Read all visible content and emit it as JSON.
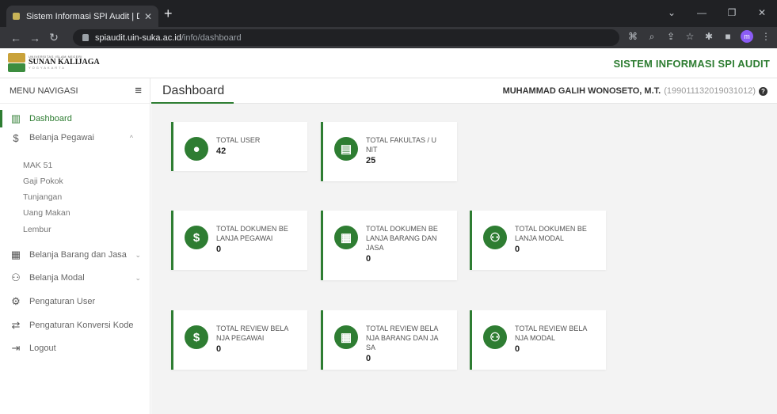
{
  "browser": {
    "tab_title": "Sistem Informasi SPI Audit | Dash",
    "url_host": "spiaudit.uin-suka.ac.id",
    "url_path": "/info/dashboard",
    "profile_initial": "m"
  },
  "header": {
    "logo_top": "UNIVERSITAS ISLAM NEGERI",
    "logo_name": "SUNAN KALIJAGA",
    "logo_city": "YOGYAKARTA",
    "app_title": "SISTEM INFORMASI SPI AUDIT"
  },
  "sidebar": {
    "title": "MENU NAVIGASI",
    "items": {
      "dashboard": "Dashboard",
      "belanja_pegawai": "Belanja Pegawai",
      "belanja_barang": "Belanja Barang dan Jasa",
      "belanja_modal": "Belanja Modal",
      "pengaturan_user": "Pengaturan User",
      "pengaturan_konversi": "Pengaturan Konversi Kode",
      "logout": "Logout"
    },
    "subitems": [
      "MAK 51",
      "Gaji Pokok",
      "Tunjangan",
      "Uang Makan",
      "Lembur"
    ]
  },
  "main": {
    "page_title": "Dashboard",
    "user_name": "MUHAMMAD GALIH WONOSETO, M.T.",
    "user_id": "(199011132019031012)"
  },
  "cards": [
    {
      "label": "TOTAL USER",
      "value": "42",
      "icon": "user-icon"
    },
    {
      "label": "TOTAL FAKULTAS / UNIT",
      "value": "25",
      "icon": "building-icon"
    },
    {
      "label": "TOTAL DOKUMEN BELANJA PEGAWAI",
      "value": "0",
      "icon": "dollar-icon"
    },
    {
      "label": "TOTAL DOKUMEN BELANJA BARANG DAN JASA",
      "value": "0",
      "icon": "calendar-icon"
    },
    {
      "label": "TOTAL DOKUMEN BELANJA MODAL",
      "value": "0",
      "icon": "people-icon"
    },
    {
      "label": "TOTAL REVIEW BELANJA PEGAWAI",
      "value": "0",
      "icon": "dollar-icon"
    },
    {
      "label": "TOTAL REVIEW BELANJA BARANG DAN JASA",
      "value": "0",
      "icon": "calendar-icon"
    },
    {
      "label": "TOTAL REVIEW BELANJA MODAL",
      "value": "0",
      "icon": "people-icon"
    }
  ]
}
